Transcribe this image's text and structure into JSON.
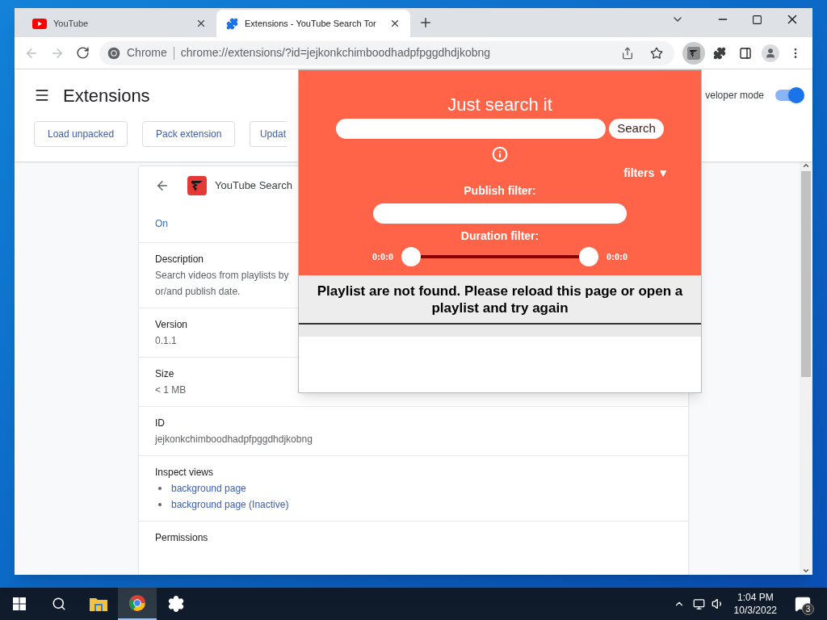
{
  "browser": {
    "tabs": [
      {
        "title": "YouTube",
        "kind": "youtube",
        "selected": false
      },
      {
        "title": "Extensions - YouTube Search Tor",
        "kind": "extension",
        "selected": true
      }
    ],
    "address_bar": {
      "site_label": "Chrome",
      "url": "chrome://extensions/?id=jejkonkchimboodhadpfpggdhdjkobng"
    }
  },
  "extensions_page": {
    "title": "Extensions",
    "developer_mode": {
      "label": "veloper mode",
      "on": true
    },
    "buttons": [
      "Load unpacked",
      "Pack extension",
      "Updat"
    ],
    "detail": {
      "name": "YouTube Search",
      "status": "On",
      "sections": [
        {
          "heading": "Description",
          "lines": [
            "Search videos from playlists by",
            "or/and publish date."
          ]
        },
        {
          "heading": "Version",
          "lines": [
            "0.1.1"
          ]
        },
        {
          "heading": "Size",
          "lines": [
            "< 1 MB"
          ]
        },
        {
          "heading": "ID",
          "lines": [
            "jejkonkchimboodhadpfpggdhdjkobng"
          ]
        },
        {
          "heading": "Inspect views",
          "links": [
            "background page",
            "background page (Inactive)"
          ]
        },
        {
          "heading": "Permissions"
        }
      ]
    }
  },
  "popup": {
    "title": "Just search it",
    "search_button": "Search",
    "filters_toggle": "filters ▼",
    "publish_filter": {
      "label": "Publish filter:"
    },
    "duration_filter": {
      "label": "Duration filter:",
      "min_reading": "0:0:0",
      "max_reading": "0:0:0",
      "start": {
        "level": 0
      },
      "end": {
        "level": 1
      }
    },
    "message": "Playlist are not found. Please reload this page or open a playlist and try again"
  },
  "taskbar": {
    "apps": [
      {
        "kind": "folder",
        "selected": false
      },
      {
        "kind": "chrome",
        "selected": true
      },
      {
        "kind": "settings",
        "selected": false
      }
    ],
    "clock": {
      "time": "1:04 PM",
      "date": "10/3/2022"
    },
    "notification_count": "3"
  }
}
